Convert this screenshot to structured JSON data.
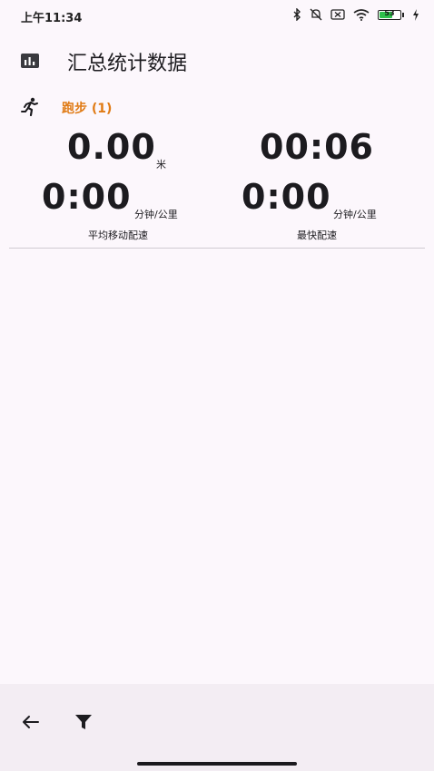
{
  "status_bar": {
    "time": "上午11:34",
    "battery_level": "53",
    "icons": [
      "bluetooth-icon",
      "silent-icon",
      "sim-off-icon",
      "wifi-icon",
      "battery-icon",
      "charging-icon"
    ]
  },
  "header": {
    "title": "汇总统计数据",
    "icon": "bar-chart-icon"
  },
  "activity": {
    "icon": "running-icon",
    "title": "跑步 (1)",
    "distance": {
      "value": "0.00",
      "unit": "米"
    },
    "duration": {
      "value": "00:06"
    },
    "avg_pace": {
      "value": "0:00",
      "unit": "分钟/公里",
      "label": "平均移动配速"
    },
    "best_pace": {
      "value": "0:00",
      "unit": "分钟/公里",
      "label": "最快配速"
    }
  },
  "bottom_bar": {
    "back_icon": "arrow-left-icon",
    "filter_icon": "filter-icon"
  },
  "colors": {
    "background": "#fcf7fc",
    "accent": "#e07b15",
    "bottom_bar": "#f3edf3"
  }
}
